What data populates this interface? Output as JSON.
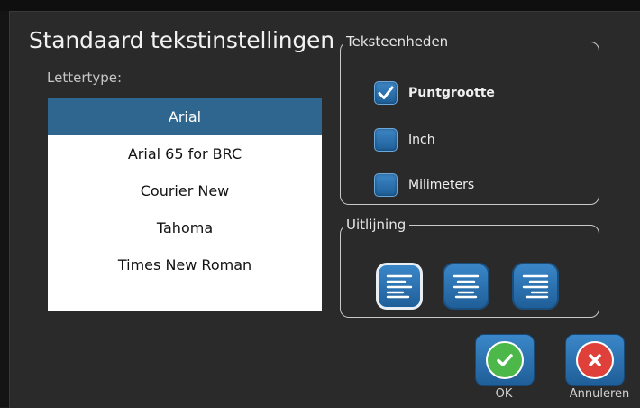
{
  "dialog": {
    "title": "Standaard tekstinstellingen",
    "font_label": "Lettertype:"
  },
  "fonts": [
    {
      "label": "Arial",
      "selected": true
    },
    {
      "label": "Arial 65 for BRC",
      "selected": false
    },
    {
      "label": "Courier New",
      "selected": false
    },
    {
      "label": "Tahoma",
      "selected": false
    },
    {
      "label": "Times New Roman",
      "selected": false
    }
  ],
  "units": {
    "legend": "Teksteenheden",
    "options": [
      {
        "label": "Puntgrootte",
        "checked": true
      },
      {
        "label": "Inch",
        "checked": false
      },
      {
        "label": "Milimeters",
        "checked": false
      }
    ]
  },
  "alignment": {
    "legend": "Uitlijning",
    "options": [
      {
        "name": "align-left-icon",
        "active": true
      },
      {
        "name": "align-center-icon",
        "active": false
      },
      {
        "name": "align-right-icon",
        "active": false
      }
    ]
  },
  "actions": {
    "ok_label": "OK",
    "cancel_label": "Annuleren"
  },
  "colors": {
    "background": "#2a2a2a",
    "selection": "#2f6690",
    "button_blue": "#2b74b5",
    "ok_green": "#4cb849",
    "cancel_red": "#e0403a"
  }
}
